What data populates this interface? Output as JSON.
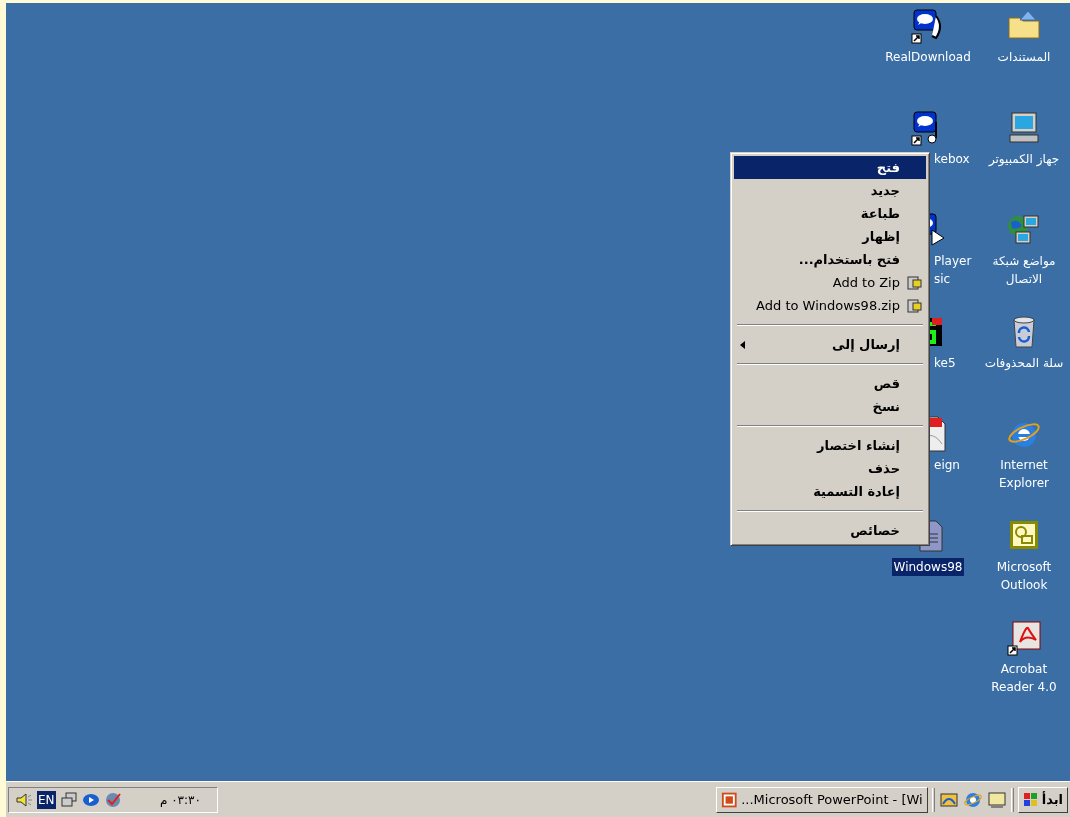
{
  "desktop": {
    "columns": [
      {
        "icons": [
          {
            "kind": "documents",
            "label": "المستندات",
            "selected": false,
            "covered": false
          },
          {
            "kind": "computer",
            "label": "جهاز الكمبيوتر",
            "selected": false,
            "covered": false
          },
          {
            "kind": "network",
            "label": "مواضع شبكة الاتصال",
            "selected": false,
            "covered": false
          },
          {
            "kind": "recycle",
            "label": "سلة المحذوفات",
            "selected": false,
            "covered": false
          },
          {
            "kind": "ie",
            "label": "Internet Explorer",
            "selected": false,
            "covered": false
          },
          {
            "kind": "outlook",
            "label": "Microsoft Outlook",
            "selected": false,
            "covered": false
          },
          {
            "kind": "acrobat",
            "label": "Acrobat Reader 4.0",
            "selected": false,
            "covered": false
          }
        ]
      },
      {
        "icons": [
          {
            "kind": "realdownload",
            "label": "RealDownload",
            "selected": false,
            "covered": false
          },
          {
            "kind": "jukebox",
            "label": "kebox",
            "selected": false,
            "covered": true
          },
          {
            "kind": "player",
            "label": "Player sic",
            "selected": false,
            "covered": true
          },
          {
            "kind": "ke5",
            "label": "ke5",
            "selected": false,
            "covered": true
          },
          {
            "kind": "pdf",
            "label": "eign",
            "selected": false,
            "covered": true
          },
          {
            "kind": "ppt",
            "label": "Windows98",
            "selected": true,
            "covered": false
          }
        ]
      }
    ]
  },
  "context_menu": {
    "items": [
      {
        "kind": "item",
        "label": "فتح",
        "selected": true
      },
      {
        "kind": "item",
        "label": "جديد",
        "selected": false
      },
      {
        "kind": "item",
        "label": "طباعة",
        "selected": false
      },
      {
        "kind": "item",
        "label": "إظهار",
        "selected": false
      },
      {
        "kind": "item",
        "label": "فتح باستخدام...",
        "selected": false
      },
      {
        "kind": "zip",
        "label": "Add to Zip",
        "selected": false
      },
      {
        "kind": "zip",
        "label": "Add to Windows98.zip",
        "selected": false
      },
      {
        "kind": "separator"
      },
      {
        "kind": "submenu",
        "label": "إرسال إلى",
        "selected": false
      },
      {
        "kind": "separator"
      },
      {
        "kind": "item",
        "label": "قص",
        "selected": false
      },
      {
        "kind": "item",
        "label": "نسخ",
        "selected": false
      },
      {
        "kind": "separator"
      },
      {
        "kind": "item",
        "label": "إنشاء اختصار",
        "selected": false
      },
      {
        "kind": "item",
        "label": "حذف",
        "selected": false
      },
      {
        "kind": "item",
        "label": "إعادة التسمية",
        "selected": false
      },
      {
        "kind": "separator"
      },
      {
        "kind": "item",
        "label": "خصائص",
        "selected": false
      }
    ]
  },
  "taskbar": {
    "start": "ابدأ",
    "tasks": [
      {
        "label": "...Microsoft PowerPoint - [Wi",
        "selected": false
      }
    ],
    "tray": {
      "language": "EN",
      "clock": "٠٣:٣٠ م"
    }
  }
}
